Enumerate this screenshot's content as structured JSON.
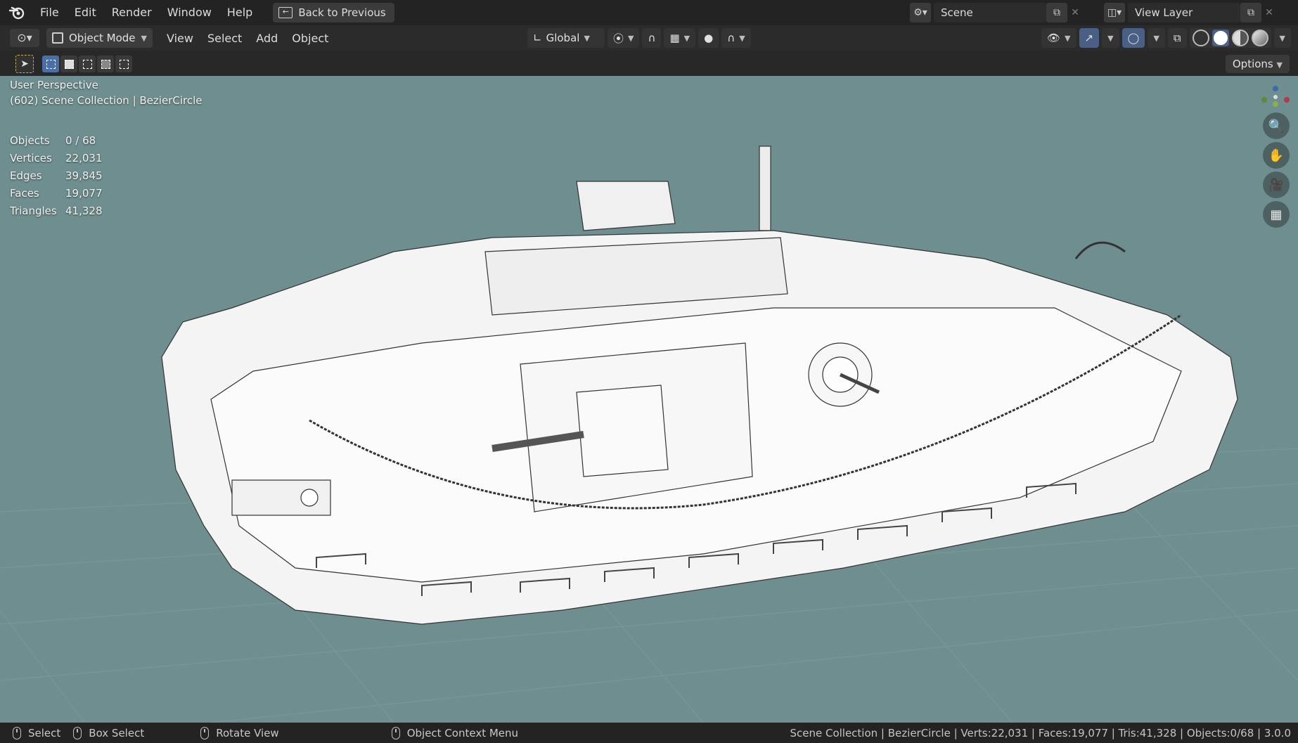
{
  "menu": {
    "logo": "blender-logo",
    "items": [
      "File",
      "Edit",
      "Render",
      "Window",
      "Help"
    ],
    "back_to_previous": "Back to Previous"
  },
  "scene": {
    "name": "Scene"
  },
  "view_layer": {
    "name": "View Layer"
  },
  "header": {
    "mode": "Object Mode",
    "menus": [
      "View",
      "Select",
      "Add",
      "Object"
    ],
    "transform_orientation": "Global"
  },
  "toolbar": {
    "options_label": "Options"
  },
  "viewport": {
    "perspective": "User Perspective",
    "collection_line": "(602) Scene Collection | BezierCircle",
    "stats": [
      {
        "label": "Objects",
        "value": "0 / 68"
      },
      {
        "label": "Vertices",
        "value": "22,031"
      },
      {
        "label": "Edges",
        "value": "39,845"
      },
      {
        "label": "Faces",
        "value": "19,077"
      },
      {
        "label": "Triangles",
        "value": "41,328"
      }
    ],
    "background_color": "#6f8e8f"
  },
  "statusbar": {
    "select": "Select",
    "box_select": "Box Select",
    "rotate_view": "Rotate View",
    "context_menu": "Object Context Menu",
    "info": "Scene Collection | BezierCircle | Verts:22,031 | Faces:19,077 | Tris:41,328 | Objects:0/68 | 3.0.0"
  },
  "colors": {
    "accent": "#4a6ea8",
    "active_tool": "#4a5f86"
  }
}
